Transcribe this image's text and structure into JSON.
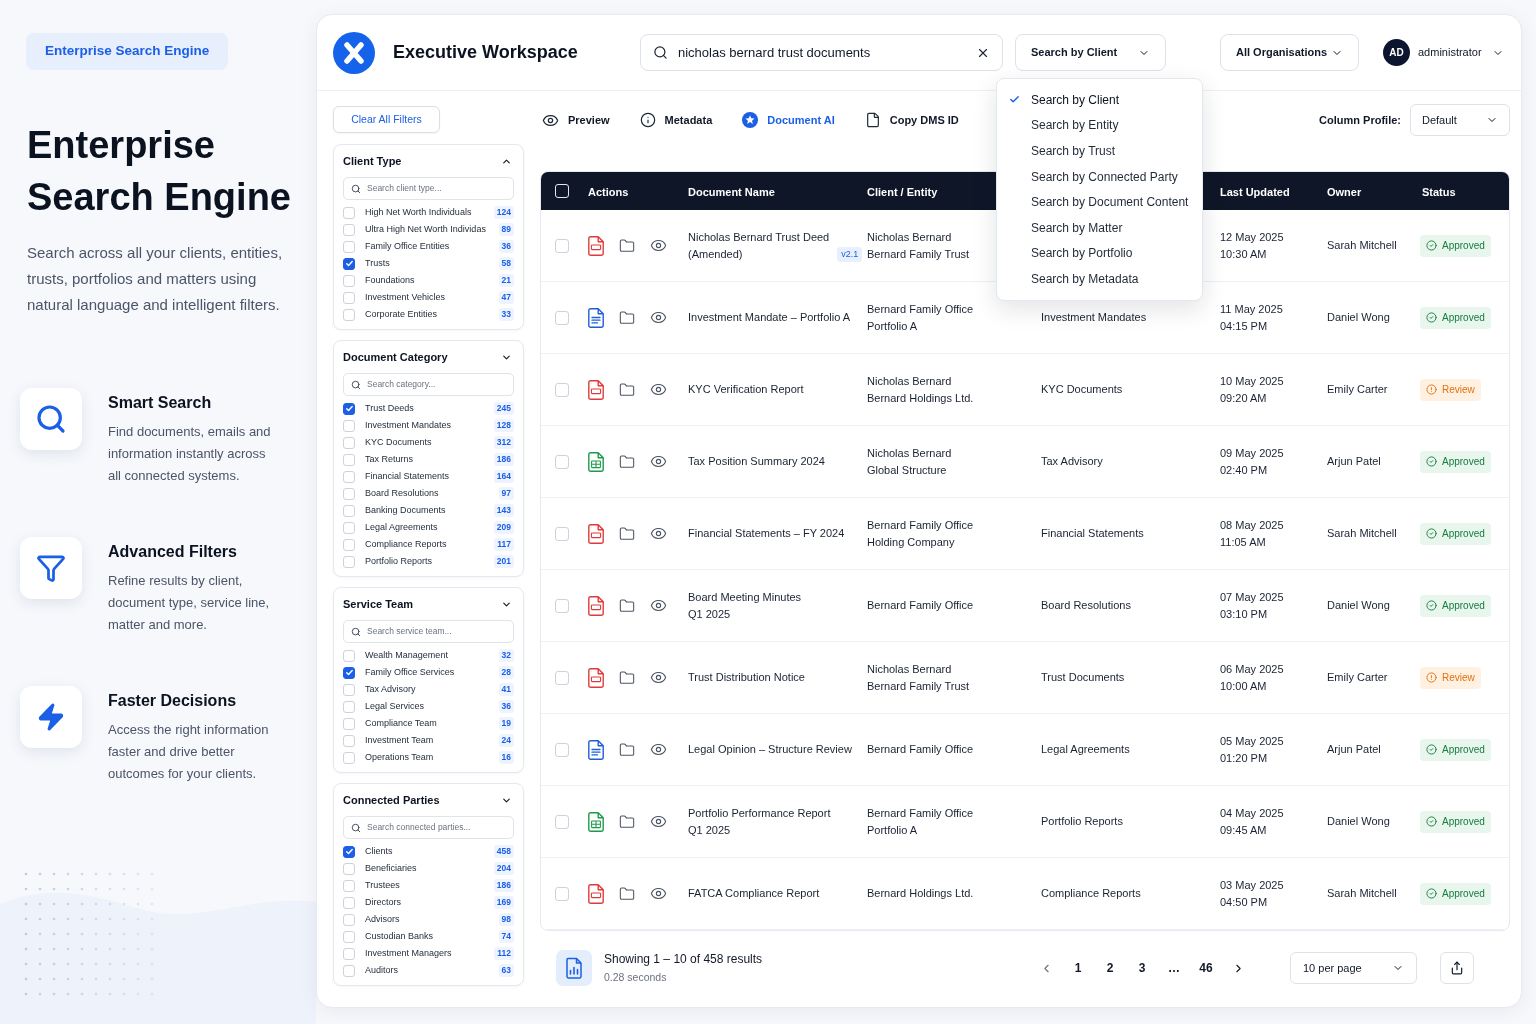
{
  "intro": {
    "tag": "Enterprise Search Engine",
    "heading": "Enterprise Search Engine",
    "text": "Search across all your clients, entities, trusts, portfolios and matters using natural language and intelligent filters.",
    "features": [
      {
        "kind": "search",
        "title": "Smart Search",
        "text": "Find documents, emails and information instantly across all connected systems."
      },
      {
        "kind": "filter",
        "title": "Advanced Filters",
        "text": "Refine results by client, document type, service line, matter and more."
      },
      {
        "kind": "bolt",
        "title": "Faster Decisions",
        "text": "Access the right information faster and drive better outcomes for your clients."
      }
    ]
  },
  "header": {
    "title": "Executive Workspace",
    "search": {
      "value": "nicholas bernard trust documents"
    },
    "search_mode": {
      "value": "Search by Client",
      "options": [
        {
          "label": "Search by Client",
          "selected": true
        },
        {
          "label": "Search by Entity",
          "selected": false
        },
        {
          "label": "Search by Trust",
          "selected": false
        },
        {
          "label": "Search by Connected Party",
          "selected": false
        },
        {
          "label": "Search by Document Content",
          "selected": false
        },
        {
          "label": "Search by Matter",
          "selected": false
        },
        {
          "label": "Search by Portfolio",
          "selected": false
        },
        {
          "label": "Search by Metadata",
          "selected": false
        }
      ]
    },
    "organisation": "All Organisations",
    "user": {
      "initials": "AD",
      "name": "administrator"
    }
  },
  "filters": {
    "clear_button": "Clear All Filters",
    "groups": [
      {
        "title": "Client Type",
        "expanded": true,
        "placeholder": "Search client type...",
        "items": [
          {
            "label": "High Net Worth Individuals",
            "count": "124",
            "checked": false
          },
          {
            "label": "Ultra High Net Worth Individas",
            "count": "89",
            "checked": false
          },
          {
            "label": "Family Office Entities",
            "count": "36",
            "checked": false
          },
          {
            "label": "Trusts",
            "count": "58",
            "checked": true
          },
          {
            "label": "Foundations",
            "count": "21",
            "checked": false
          },
          {
            "label": "Investment Vehicles",
            "count": "47",
            "checked": false
          },
          {
            "label": "Corporate Entities",
            "count": "33",
            "checked": false
          }
        ]
      },
      {
        "title": "Document Category",
        "expanded": false,
        "placeholder": "Search category...",
        "items": [
          {
            "label": "Trust Deeds",
            "count": "245",
            "checked": true
          },
          {
            "label": "Investment Mandates",
            "count": "128",
            "checked": false
          },
          {
            "label": "KYC Documents",
            "count": "312",
            "checked": false
          },
          {
            "label": "Tax Returns",
            "count": "186",
            "checked": false
          },
          {
            "label": "Financial Statements",
            "count": "164",
            "checked": false
          },
          {
            "label": "Board Resolutions",
            "count": "97",
            "checked": false
          },
          {
            "label": "Banking Documents",
            "count": "143",
            "checked": false
          },
          {
            "label": "Legal Agreements",
            "count": "209",
            "checked": false
          },
          {
            "label": "Compliance Reports",
            "count": "117",
            "checked": false
          },
          {
            "label": "Portfolio Reports",
            "count": "201",
            "checked": false
          }
        ]
      },
      {
        "title": "Service Team",
        "expanded": false,
        "placeholder": "Search service team...",
        "items": [
          {
            "label": "Wealth Management",
            "count": "32",
            "checked": false
          },
          {
            "label": "Family Office Services",
            "count": "28",
            "checked": true
          },
          {
            "label": "Tax Advisory",
            "count": "41",
            "checked": false
          },
          {
            "label": "Legal Services",
            "count": "36",
            "checked": false
          },
          {
            "label": "Compliance Team",
            "count": "19",
            "checked": false
          },
          {
            "label": "Investment Team",
            "count": "24",
            "checked": false
          },
          {
            "label": "Operations Team",
            "count": "16",
            "checked": false
          }
        ]
      },
      {
        "title": "Connected Parties",
        "expanded": false,
        "placeholder": "Search connected parties...",
        "items": [
          {
            "label": "Clients",
            "count": "458",
            "checked": true
          },
          {
            "label": "Beneficiaries",
            "count": "204",
            "checked": false
          },
          {
            "label": "Trustees",
            "count": "186",
            "checked": false
          },
          {
            "label": "Directors",
            "count": "169",
            "checked": false
          },
          {
            "label": "Advisors",
            "count": "98",
            "checked": false
          },
          {
            "label": "Custodian Banks",
            "count": "74",
            "checked": false
          },
          {
            "label": "Investment Managers",
            "count": "112",
            "checked": false
          },
          {
            "label": "Auditors",
            "count": "63",
            "checked": false
          }
        ]
      }
    ]
  },
  "toolbar": {
    "actions": [
      {
        "kind": "preview",
        "label": "Preview",
        "selected": false
      },
      {
        "kind": "metadata",
        "label": "Metadata",
        "selected": false
      },
      {
        "kind": "ai",
        "label": "Document AI",
        "selected": true
      },
      {
        "kind": "copy",
        "label": "Copy DMS ID",
        "selected": false
      }
    ],
    "column_profile": {
      "label": "Column Profile:",
      "value": "Default"
    }
  },
  "table": {
    "select_all": {
      "checked": false
    },
    "columns": [
      "Actions",
      "Document Name",
      "Client / Entity",
      "Last Updated",
      "Owner",
      "Status"
    ],
    "rows": [
      {
        "checked": false,
        "kind": "pdf",
        "name": [
          "Nicholas Bernard Trust Deed",
          "(Amended)"
        ],
        "version": "v2.1",
        "client": [
          "Nicholas Bernard",
          "Bernard Family Trust"
        ],
        "updated": [
          "12 May 2025",
          "10:30 AM"
        ],
        "owner": "Sarah Mitchell",
        "status": {
          "kind": "approved",
          "label": "Approved"
        }
      },
      {
        "checked": false,
        "kind": "word",
        "name": [
          "Investment Mandate – Portfolio A"
        ],
        "client": [
          "Bernard Family Office",
          "Portfolio A"
        ],
        "category": "Investment Mandates",
        "updated": [
          "11 May 2025",
          "04:15 PM"
        ],
        "owner": "Daniel Wong",
        "status": {
          "kind": "approved",
          "label": "Approved"
        }
      },
      {
        "checked": false,
        "kind": "pdf",
        "name": [
          "KYC Verification Report"
        ],
        "client": [
          "Nicholas Bernard",
          "Bernard Holdings Ltd."
        ],
        "category": "KYC Documents",
        "updated": [
          "10 May 2025",
          "09:20 AM"
        ],
        "owner": "Emily Carter",
        "status": {
          "kind": "review",
          "label": "Review"
        }
      },
      {
        "checked": false,
        "kind": "excel",
        "name": [
          "Tax Position Summary 2024"
        ],
        "client": [
          "Nicholas Bernard",
          "Global Structure"
        ],
        "category": "Tax Advisory",
        "updated": [
          "09 May 2025",
          "02:40 PM"
        ],
        "owner": "Arjun Patel",
        "status": {
          "kind": "approved",
          "label": "Approved"
        }
      },
      {
        "checked": false,
        "kind": "pdf",
        "name": [
          "Financial Statements – FY 2024"
        ],
        "client": [
          "Bernard Family Office",
          "Holding Company"
        ],
        "category": "Financial Statements",
        "updated": [
          "08 May 2025",
          "11:05 AM"
        ],
        "owner": "Sarah Mitchell",
        "status": {
          "kind": "approved",
          "label": "Approved"
        }
      },
      {
        "checked": false,
        "kind": "pdf",
        "name": [
          "Board Meeting Minutes",
          "Q1 2025"
        ],
        "client": [
          "Bernard Family Office"
        ],
        "category": "Board Resolutions",
        "updated": [
          "07 May 2025",
          "03:10 PM"
        ],
        "owner": "Daniel Wong",
        "status": {
          "kind": "approved",
          "label": "Approved"
        }
      },
      {
        "checked": false,
        "kind": "pdf",
        "name": [
          "Trust Distribution Notice"
        ],
        "client": [
          "Nicholas Bernard",
          "Bernard Family Trust"
        ],
        "category": "Trust Documents",
        "updated": [
          "06 May 2025",
          "10:00 AM"
        ],
        "owner": "Emily Carter",
        "status": {
          "kind": "review",
          "label": "Review"
        }
      },
      {
        "checked": false,
        "kind": "word",
        "name": [
          "Legal Opinion – Structure Review"
        ],
        "client": [
          "Bernard Family Office"
        ],
        "category": "Legal Agreements",
        "updated": [
          "05 May 2025",
          "01:20 PM"
        ],
        "owner": "Arjun Patel",
        "status": {
          "kind": "approved",
          "label": "Approved"
        }
      },
      {
        "checked": false,
        "kind": "excel",
        "name": [
          "Portfolio Performance Report",
          "Q1 2025"
        ],
        "client": [
          "Bernard Family Office",
          "Portfolio A"
        ],
        "category": "Portfolio Reports",
        "updated": [
          "04 May 2025",
          "09:45 AM"
        ],
        "owner": "Daniel Wong",
        "status": {
          "kind": "approved",
          "label": "Approved"
        }
      },
      {
        "checked": false,
        "kind": "pdf",
        "name": [
          "FATCA Compliance Report"
        ],
        "client": [
          "Bernard Holdings Ltd."
        ],
        "category": "Compliance Reports",
        "updated": [
          "03 May 2025",
          "04:50 PM"
        ],
        "owner": "Sarah Mitchell",
        "status": {
          "kind": "approved",
          "label": "Approved"
        }
      }
    ]
  },
  "footer": {
    "summary": "Showing 1 – 10 of 458 results",
    "timing": "0.28 seconds",
    "pages": [
      "1",
      "2",
      "3",
      "…",
      "46"
    ],
    "page_size": "10 per page"
  }
}
